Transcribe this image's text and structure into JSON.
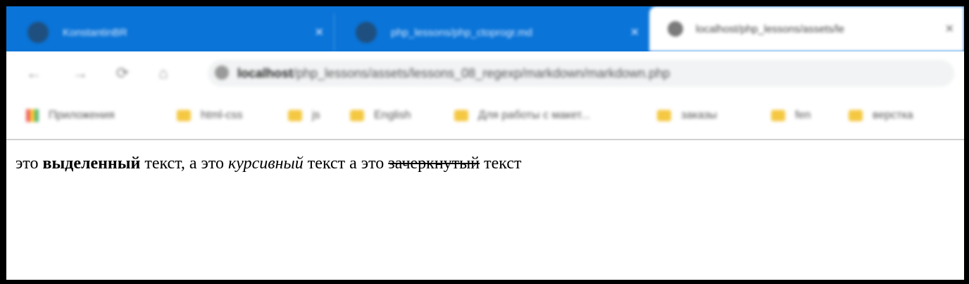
{
  "browser": {
    "tabs": [
      {
        "title": "KonstantinBR",
        "close": "✕"
      },
      {
        "title": "php_lessons/php_ctoprogr.md",
        "close": "✕"
      },
      {
        "title": "localhost/php_lessons/assets/le",
        "close": "✕",
        "active": true
      }
    ],
    "toolbar": {
      "back": "←",
      "forward": "→",
      "reload": "⟳",
      "home": "⌂",
      "url_host": "localhost",
      "url_path": "/php_lessons/assets/lessons_08_regexp/markdown/markdown.php"
    },
    "bookmarks": [
      {
        "label": "Приложения",
        "icon": "apps-icon"
      },
      {
        "label": "html-css",
        "icon": "folder-icon"
      },
      {
        "label": "js",
        "icon": "folder-icon"
      },
      {
        "label": "English",
        "icon": "folder-icon"
      },
      {
        "label": "Для работы с макет...",
        "icon": "folder-icon"
      },
      {
        "label": "заказы",
        "icon": "folder-icon"
      },
      {
        "label": "fen",
        "icon": "folder-icon"
      },
      {
        "label": "верстка",
        "icon": "folder-icon"
      }
    ]
  },
  "page": {
    "t1": "это ",
    "bold": "выделенный",
    "t2": " текст, а это ",
    "italic": "курсивный",
    "t3": " текст а это ",
    "strike": "зачеркнутый",
    "t4": " текст"
  }
}
